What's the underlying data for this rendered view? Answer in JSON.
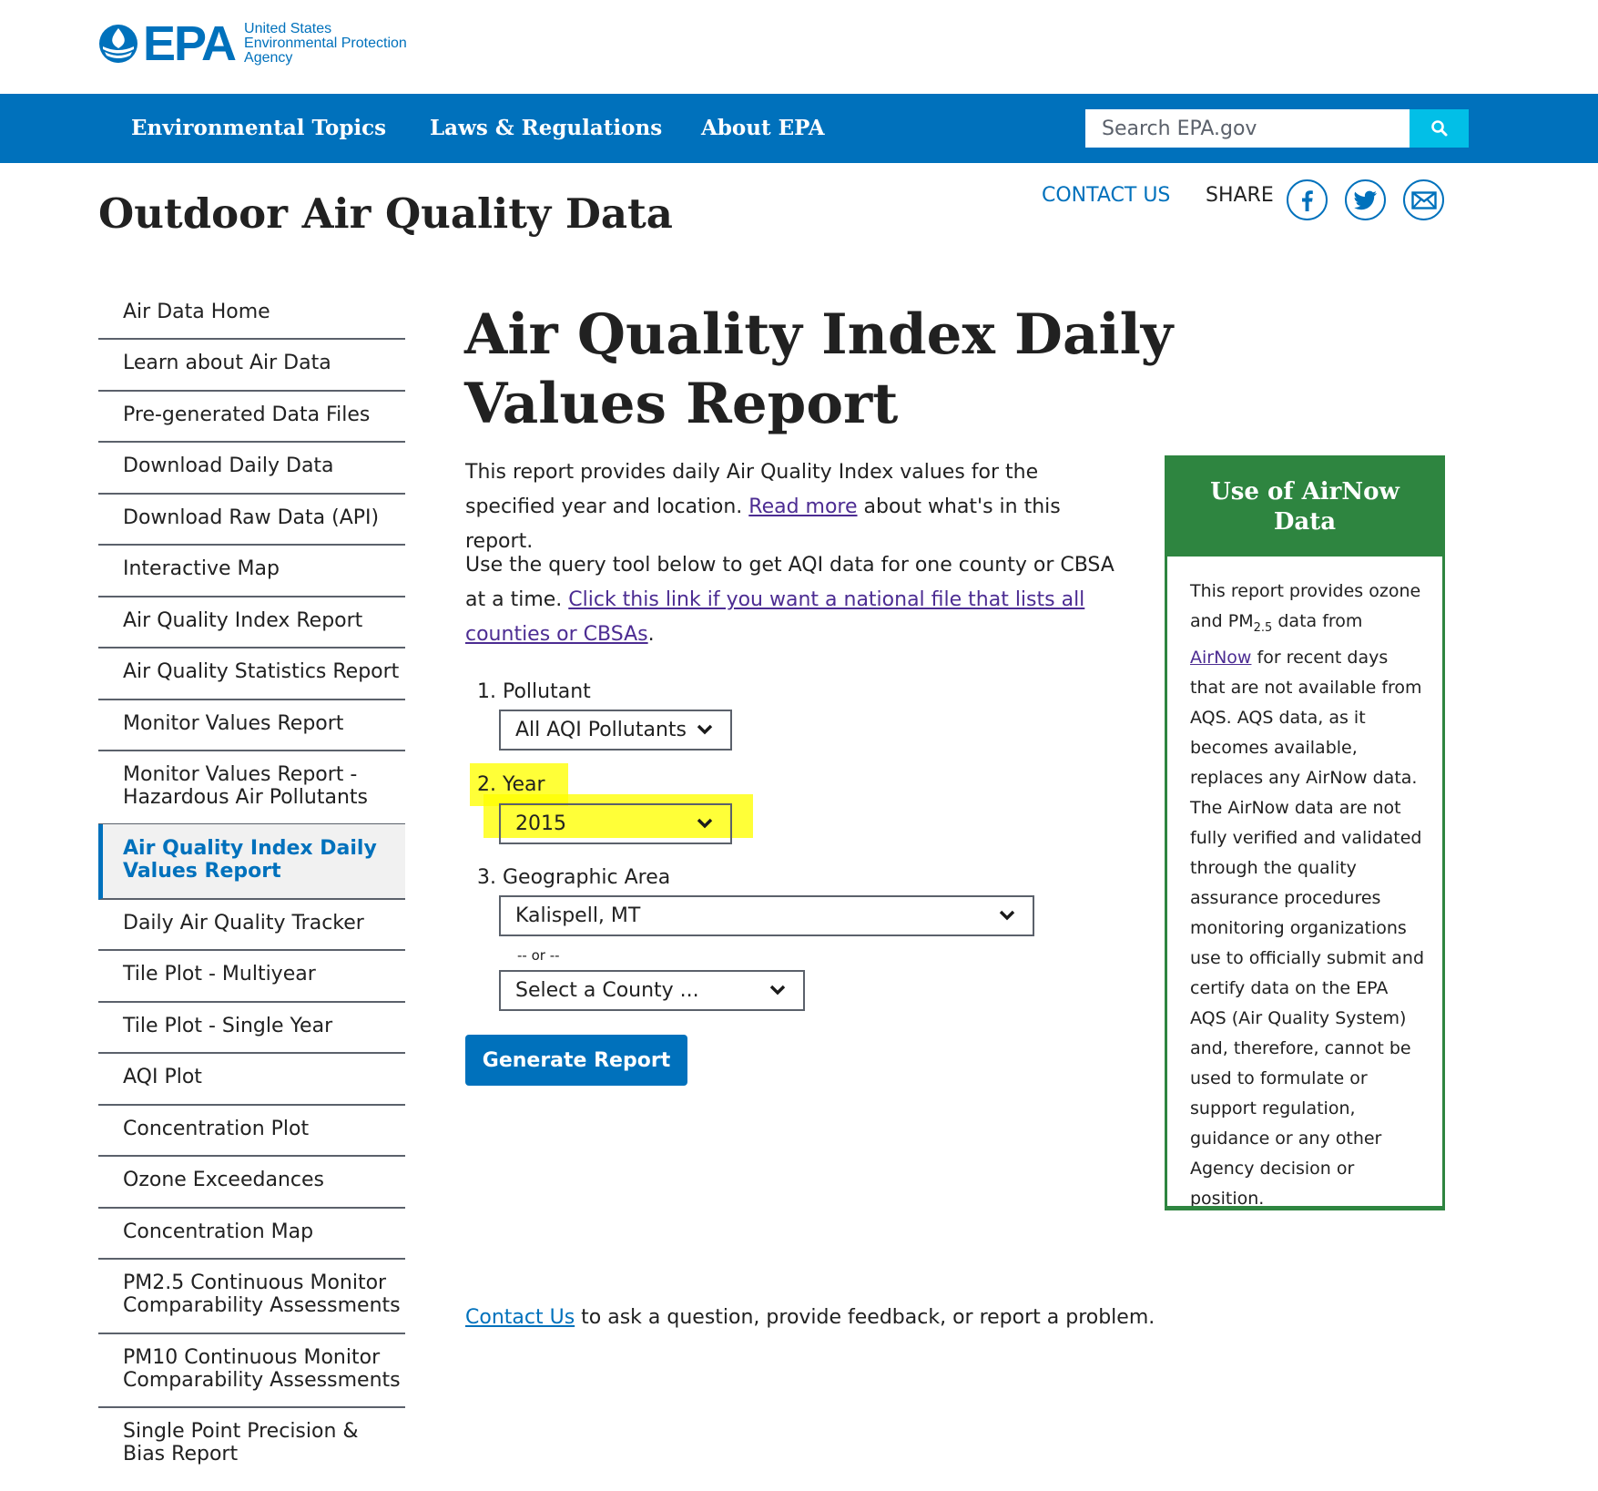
{
  "header": {
    "logo_wordmark": "EPA",
    "logo_lines": [
      "United States",
      "Environmental Protection",
      "Agency"
    ]
  },
  "nav": {
    "items": [
      "Environmental Topics",
      "Laws & Regulations",
      "About EPA"
    ],
    "search_placeholder": "Search EPA.gov",
    "search_icon": "search-icon"
  },
  "site_title": "Outdoor Air Quality Data",
  "utility": {
    "contact": "CONTACT US",
    "share": "SHARE",
    "share_icons": [
      "facebook-icon",
      "twitter-icon",
      "email-icon"
    ]
  },
  "sidebar": {
    "items": [
      {
        "label": "Air Data Home"
      },
      {
        "label": "Learn about Air Data"
      },
      {
        "label": "Pre-generated Data Files"
      },
      {
        "label": "Download Daily Data"
      },
      {
        "label": "Download Raw Data (API)"
      },
      {
        "label": "Interactive Map"
      },
      {
        "label": "Air Quality Index Report"
      },
      {
        "label": "Air Quality Statistics Report"
      },
      {
        "label": "Monitor Values Report"
      },
      {
        "label": "Monitor Values Report - Hazardous Air Pollutants"
      },
      {
        "label": "Air Quality Index Daily Values Report",
        "active": true
      },
      {
        "label": "Daily Air Quality Tracker"
      },
      {
        "label": "Tile Plot - Multiyear"
      },
      {
        "label": "Tile Plot - Single Year"
      },
      {
        "label": "AQI Plot"
      },
      {
        "label": "Concentration Plot"
      },
      {
        "label": "Ozone Exceedances"
      },
      {
        "label": "Concentration Map"
      },
      {
        "label": "PM2.5 Continuous Monitor Comparability Assessments"
      },
      {
        "label": "PM10 Continuous Monitor Comparability Assessments"
      },
      {
        "label": "Single Point Precision & Bias Report"
      }
    ]
  },
  "main": {
    "title": "Air Quality Index Daily Values Report",
    "intro": {
      "before": "This report provides daily Air Quality Index values for the specified year and location. ",
      "link": "Read more",
      "after": " about what's in this report."
    },
    "query": {
      "before": "Use the query tool below to get AQI data for one county or CBSA at a time. ",
      "link": "Click this link if you want a national file that lists all counties or CBSAs",
      "after": "."
    },
    "form": {
      "pollutant_label": "1. Pollutant",
      "pollutant_value": "All AQI Pollutants",
      "year_label": "2. Year",
      "year_value": "2015",
      "geo_label": "3. Geographic Area",
      "geo_value": "Kalispell, MT",
      "or_text": "-- or --",
      "county_value": "Select a County ...",
      "button": "Generate Report"
    },
    "footer": {
      "link": "Contact Us",
      "text": " to ask a question, provide feedback, or report a problem."
    },
    "highlight_color": "#ffff00"
  },
  "airnow_box": {
    "title": "Use of AirNow Data",
    "body_before": "This report provides ozone and PM",
    "body_sub": "2.5",
    "body_mid": " data from ",
    "body_link": "AirNow",
    "body_after": " for recent days that are not available from AQS. AQS data, as it becomes available, replaces any AirNow data. The AirNow data are not fully verified and validated through the quality assurance procedures monitoring organizations use to officially submit and certify data on the EPA AQS (Air Quality System) and, therefore, cannot be used to formulate or support regulation, guidance or any other Agency decision or position."
  },
  "colors": {
    "epa_blue": "#0071bc",
    "search_button": "#02bfe7",
    "airnow_green": "#2e8540",
    "visited_link": "#4c2c92"
  }
}
